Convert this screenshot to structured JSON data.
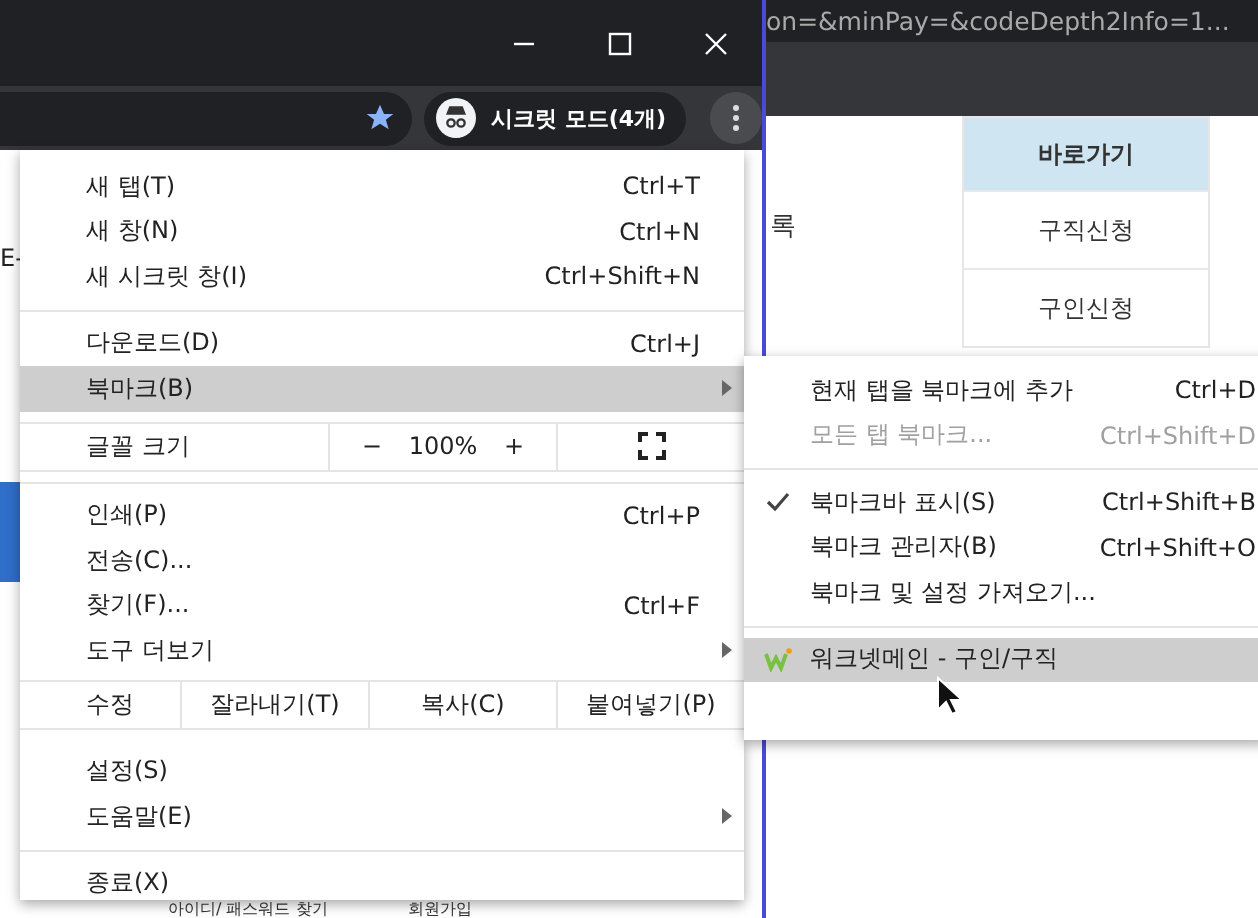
{
  "background_window": {
    "address_text": "on=&minPay=&codeDepth2Info=1...",
    "page_text": "록",
    "quick_links": [
      {
        "label": "바로가기",
        "kind": "header"
      },
      {
        "label": "구직신청",
        "kind": "link"
      },
      {
        "label": "구인신청",
        "kind": "link"
      }
    ]
  },
  "browser": {
    "incognito_label": "시크릿 모드(4개)",
    "side_text": "E-",
    "footer_links": [
      "아이디/ 패스워드 찾기",
      "회원가입"
    ]
  },
  "menu": {
    "items": [
      {
        "kind": "item",
        "label": "새 탭(T)",
        "shortcut": "Ctrl+T",
        "submenu": false,
        "selected": false
      },
      {
        "kind": "item",
        "label": "새 창(N)",
        "shortcut": "Ctrl+N",
        "submenu": false,
        "selected": false
      },
      {
        "kind": "item",
        "label": "새 시크릿 창(I)",
        "shortcut": "Ctrl+Shift+N",
        "submenu": false,
        "selected": false
      },
      {
        "kind": "separator"
      },
      {
        "kind": "item",
        "label": "다운로드(D)",
        "shortcut": "Ctrl+J",
        "submenu": false,
        "selected": false
      },
      {
        "kind": "item",
        "label": "북마크(B)",
        "submenu": true,
        "selected": true
      },
      {
        "kind": "separator"
      },
      {
        "kind": "zoom",
        "label": "글꼴 크기",
        "minus": "−",
        "value": "100%",
        "plus": "+"
      },
      {
        "kind": "separator"
      },
      {
        "kind": "item",
        "label": "인쇄(P)",
        "shortcut": "Ctrl+P",
        "submenu": false,
        "selected": false
      },
      {
        "kind": "item",
        "label": "전송(C)...",
        "submenu": false,
        "selected": false
      },
      {
        "kind": "item",
        "label": "찾기(F)...",
        "shortcut": "Ctrl+F",
        "submenu": false,
        "selected": false
      },
      {
        "kind": "item",
        "label": "도구 더보기",
        "submenu": true,
        "selected": false
      },
      {
        "kind": "edit",
        "label": "수정",
        "buttons": [
          "잘라내기(T)",
          "복사(C)",
          "붙여넣기(P)"
        ]
      },
      {
        "kind": "item",
        "label": "설정(S)",
        "submenu": false,
        "selected": false
      },
      {
        "kind": "item",
        "label": "도움말(E)",
        "submenu": true,
        "selected": false
      },
      {
        "kind": "separator"
      },
      {
        "kind": "item",
        "label": "종료(X)",
        "submenu": false,
        "selected": false
      }
    ]
  },
  "submenu": {
    "items": [
      {
        "kind": "item",
        "label": "현재 탭을 북마크에 추가",
        "shortcut": "Ctrl+D",
        "disabled": false,
        "checked": false,
        "selected": false
      },
      {
        "kind": "item",
        "label": "모든 탭 북마크...",
        "shortcut": "Ctrl+Shift+D",
        "disabled": true,
        "checked": false,
        "selected": false
      },
      {
        "kind": "separator"
      },
      {
        "kind": "item",
        "label": "북마크바 표시(S)",
        "shortcut": "Ctrl+Shift+B",
        "disabled": false,
        "checked": true,
        "selected": false
      },
      {
        "kind": "item",
        "label": "북마크 관리자(B)",
        "shortcut": "Ctrl+Shift+O",
        "disabled": false,
        "checked": false,
        "selected": false
      },
      {
        "kind": "item",
        "label": "북마크 및 설정 가져오기...",
        "disabled": false,
        "checked": false,
        "selected": false
      },
      {
        "kind": "separator"
      },
      {
        "kind": "bookmark",
        "label": "워크넷메인 - 구인/구직",
        "disabled": false,
        "checked": false,
        "selected": true
      }
    ]
  }
}
